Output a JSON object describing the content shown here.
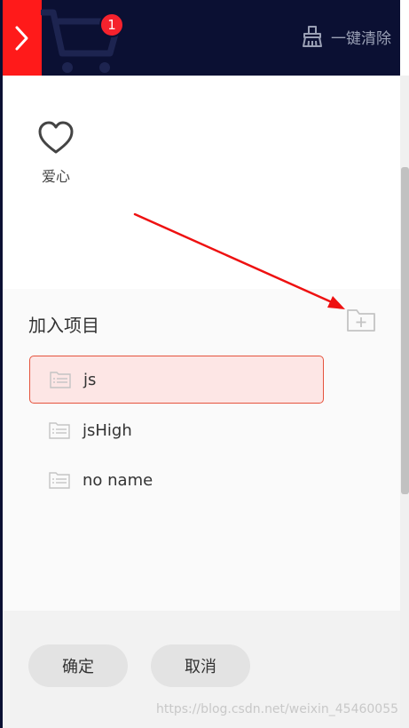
{
  "header": {
    "cart_badge": "1",
    "clear_label": "一键清除"
  },
  "favorite": {
    "label": "爱心"
  },
  "section": {
    "title": "加入项目"
  },
  "projects": [
    {
      "label": "js",
      "selected": true
    },
    {
      "label": "jsHigh",
      "selected": false
    },
    {
      "label": "no name",
      "selected": false
    }
  ],
  "footer": {
    "confirm_label": "确定",
    "cancel_label": "取消"
  },
  "watermark": "https://blog.csdn.net/weixin_45460055",
  "colors": {
    "header_bg": "#0b1033",
    "accent_red": "#ff1a1a",
    "selected_bg": "#fde6e5",
    "selected_border": "#e5533d"
  }
}
